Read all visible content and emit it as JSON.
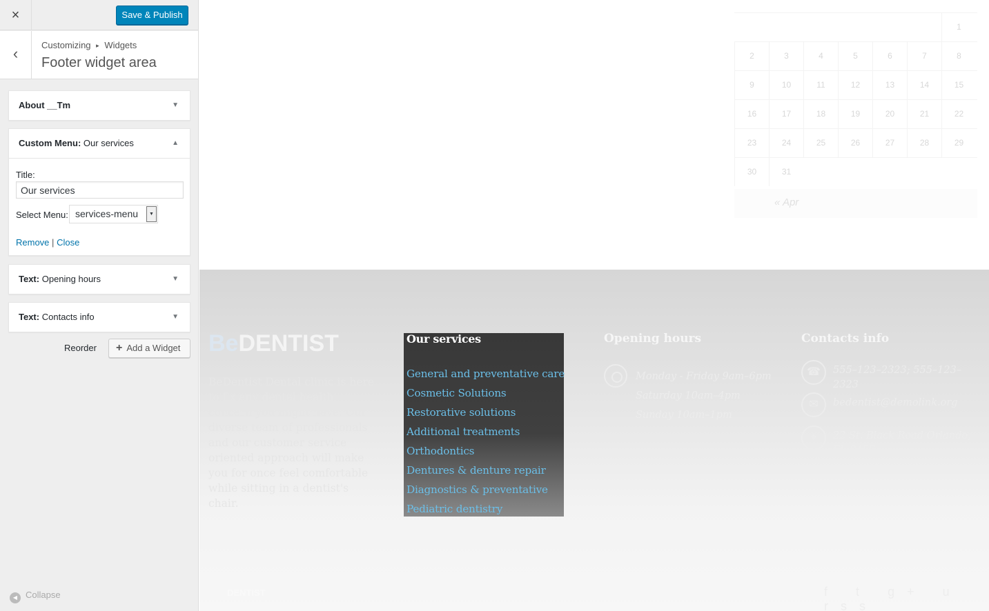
{
  "customizer": {
    "close_icon": "×",
    "save_label": "Save & Publish",
    "back_icon": "‹",
    "breadcrumb": {
      "root": "Customizing",
      "sep": "▸",
      "current": "Widgets"
    },
    "section_title": "Footer widget area",
    "widgets": [
      {
        "type": "",
        "name": "About __Tm",
        "expanded": false
      },
      {
        "type": "Custom Menu:",
        "name": "Our services",
        "expanded": true
      },
      {
        "type": "Text:",
        "name": "Opening hours",
        "expanded": false
      },
      {
        "type": "Text:",
        "name": "Contacts info",
        "expanded": false
      }
    ],
    "form": {
      "title_label": "Title:",
      "title_value": "Our services",
      "menu_label": "Select Menu:",
      "menu_value": "services-menu",
      "remove": "Remove",
      "divider": "|",
      "close": "Close"
    },
    "reorder": "Reorder",
    "add_widget": "Add a Widget",
    "collapse": "Collapse",
    "accent": "#0085ba",
    "link_color": "#0073aa"
  },
  "preview": {
    "calendar": {
      "days": [
        "1",
        "2",
        "3",
        "4",
        "5",
        "6",
        "7",
        "8",
        "9",
        "10",
        "11",
        "12",
        "13",
        "14",
        "15",
        "16",
        "17",
        "18",
        "19",
        "20",
        "21",
        "22",
        "23",
        "24",
        "25",
        "26",
        "27",
        "28",
        "29",
        "30",
        "31"
      ],
      "prev": "« Apr"
    },
    "footer": {
      "brand_prefix": "Be",
      "brand_main": "DENTIST",
      "about": "BeDentist Dental clinic is here to fix any dental health concern you might have. Our diverse team of professionals and our customer service oriented approach will make you for once feel comfortable while sitting in a dentist's chair.",
      "services_title": "Our services",
      "services": [
        "General and preventative care",
        "Cosmetic Solutions",
        "Restorative solutions",
        "Additional treatments",
        "Orthodontics",
        "Dentures & denture repair",
        "Diagnostics & preventative",
        "Pediatric dentistry"
      ],
      "hours_title": "Opening hours",
      "hours": [
        "Monday - Friday 9am–6pm",
        "Saturday 10am–4pm",
        "Sunday 10am–1pm"
      ],
      "contacts_title": "Contacts info",
      "phone": "555–123–2323; 555–123–2323",
      "email": "bedentist@demolink.org",
      "address": "22 St. Black Road Orlando, FL 3457",
      "copyright_main": "DENTIST",
      "socials": [
        "f",
        "t",
        "g+",
        "u",
        "rss"
      ]
    }
  }
}
